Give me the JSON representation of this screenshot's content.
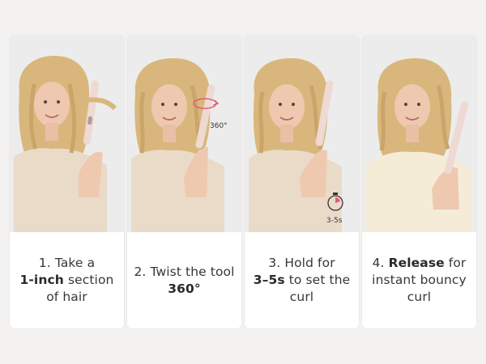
{
  "steps": [
    {
      "num": "1.",
      "pre": "Take a",
      "bold": "1-inch",
      "post": "section of hair"
    },
    {
      "num": "2.",
      "pre": "Twist the tool",
      "bold": "360°",
      "post": "",
      "overlay": "360°"
    },
    {
      "num": "3.",
      "pre": "Hold for",
      "bold": "3–5s",
      "post": "to set the curl",
      "overlay": "3-5s"
    },
    {
      "num": "4.",
      "pre": "",
      "bold": "Release",
      "post": "for instant bouncy curl"
    }
  ],
  "colors": {
    "page_bg": "#f3f2f1",
    "card_bg": "#ffffff",
    "photo_bg": "#ececec",
    "hair": "#d9b77c",
    "skin": "#eec9b0",
    "top": "#eadbc9",
    "tool": "#efd9d3",
    "accent": "#e05a7a"
  },
  "icons": {
    "rotate": "rotate-360-icon",
    "timer": "stopwatch-icon"
  }
}
